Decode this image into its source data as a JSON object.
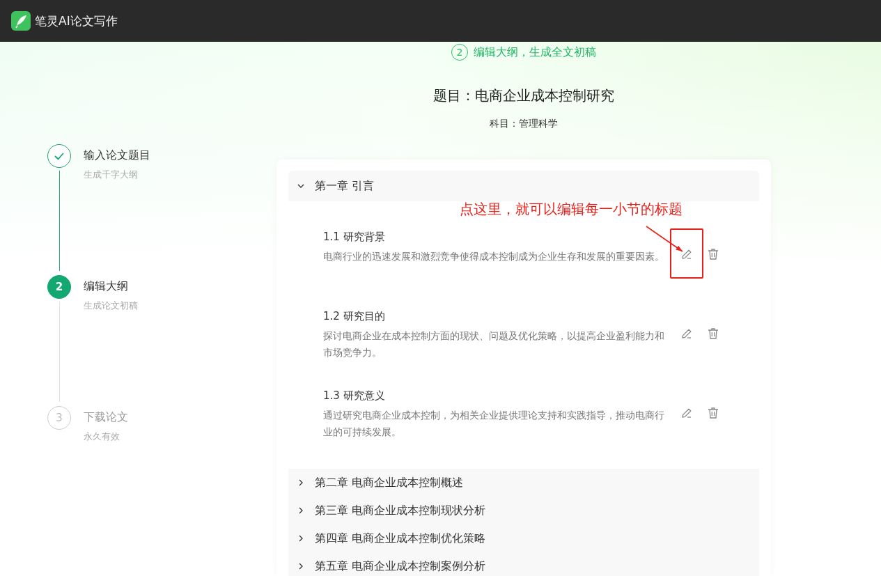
{
  "app": {
    "title": "笔灵AI论文写作"
  },
  "step_banner": {
    "number": "2",
    "text": "编辑大纲，生成全文初稿"
  },
  "paper": {
    "title": "题目：电商企业成本控制研究",
    "subject": "科目：管理科学"
  },
  "steps": [
    {
      "kind": "done",
      "title": "输入论文题目",
      "subtitle": "生成千字大纲"
    },
    {
      "kind": "active",
      "number": "2",
      "title": "编辑大纲",
      "subtitle": "生成论文初稿"
    },
    {
      "kind": "pending",
      "number": "3",
      "title": "下载论文",
      "subtitle": "永久有效"
    }
  ],
  "chapters": [
    {
      "title": "第一章 引言",
      "expanded": true,
      "sections": [
        {
          "title": "1.1 研究背景",
          "highlighted": true,
          "description": "电商行业的迅速发展和激烈竞争使得成本控制成为企业生存和发展的重要因素。"
        },
        {
          "title": "1.2 研究目的",
          "description": "探讨电商企业在成本控制方面的现状、问题及优化策略，以提高企业盈利能力和市场竞争力。"
        },
        {
          "title": "1.3 研究意义",
          "description": "通过研究电商企业成本控制，为相关企业提供理论支持和实践指导，推动电商行业的可持续发展。"
        }
      ]
    },
    {
      "title": "第二章 电商企业成本控制概述",
      "expanded": false
    },
    {
      "title": "第三章 电商企业成本控制现状分析",
      "expanded": false
    },
    {
      "title": "第四章 电商企业成本控制优化策略",
      "expanded": false
    },
    {
      "title": "第五章 电商企业成本控制案例分析",
      "expanded": false
    }
  ],
  "annotation": {
    "text": "点这里，就可以编辑每一小节的标题"
  }
}
